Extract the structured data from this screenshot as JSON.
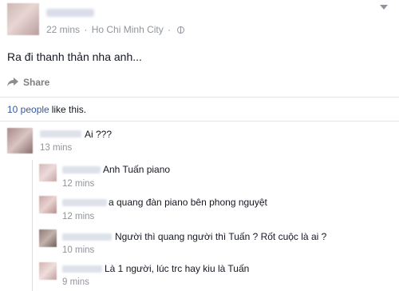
{
  "post": {
    "time": "22 mins",
    "separator": "·",
    "location": "Ho Chi Minh City",
    "extra_separator": "·",
    "text": "Ra đi thanh thản nha anh...",
    "share_label": "Share",
    "likes_link": "10 people",
    "likes_suffix": "like this."
  },
  "comments": [
    {
      "text": "Ai ???",
      "time": "13 mins"
    }
  ],
  "replies": [
    {
      "text": "Anh Tuấn piano",
      "time": "12 mins"
    },
    {
      "text": "a quang đàn piano bên phong nguyệt",
      "time": "12 mins"
    },
    {
      "text": "Người thì quang người thì Tuấn ? Rốt cuộc là ai ?",
      "time": "10 mins"
    },
    {
      "text": "Là 1 người, lúc trc hay kiu là Tuấn",
      "time": "9 mins"
    }
  ],
  "icons": {
    "privacy": "globe-icon",
    "menu": "chevron-down-icon",
    "share": "share-icon"
  }
}
